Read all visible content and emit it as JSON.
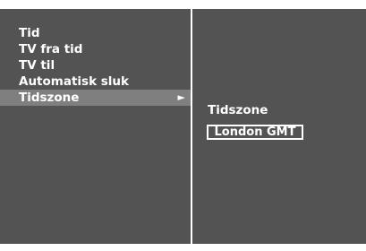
{
  "menu": {
    "items": [
      {
        "label": "Tid"
      },
      {
        "label": "TV fra tid"
      },
      {
        "label": "TV til"
      },
      {
        "label": "Automatisk sluk"
      },
      {
        "label": "Tidszone",
        "arrow": "►"
      }
    ],
    "selected_index": 4
  },
  "submenu": {
    "title": "Tidszone",
    "value": "London GMT"
  },
  "colors": {
    "panel": "#535353",
    "highlight": "#7f7f7f",
    "text": "#ffffff",
    "background": "#ffffff"
  },
  "icons": {
    "submenu_arrow": "arrow-right-icon"
  }
}
